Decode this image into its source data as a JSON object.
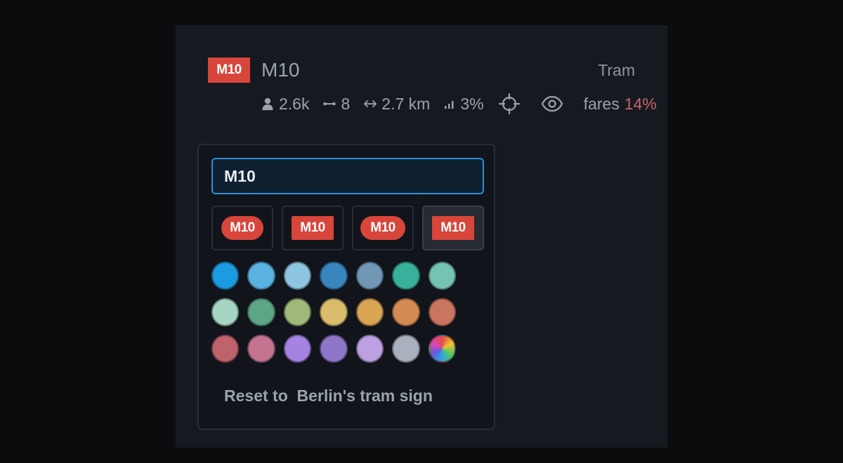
{
  "line": {
    "badge": "M10",
    "name": "M10",
    "type": "Tram",
    "badge_color": "#d8453a"
  },
  "stats": {
    "riders": "2.6k",
    "stops": "8",
    "length": "2.7 km",
    "share": "3%",
    "fares_label": "fares",
    "fares_value": "14%"
  },
  "picker": {
    "input_value": "M10",
    "style_options": [
      {
        "label": "M10",
        "shape": "pill"
      },
      {
        "label": "M10",
        "shape": "rectangle"
      },
      {
        "label": "M10",
        "shape": "pill"
      },
      {
        "label": "M10",
        "shape": "square",
        "selected": true
      }
    ],
    "swatch_rows": [
      [
        "#1b9be0",
        "#5ab2e0",
        "#8ec5e0",
        "#3a85bd",
        "#7097b4",
        "#38b19c",
        "#75c4b2"
      ],
      [
        "#a6d6c3",
        "#5da584",
        "#a0b97a",
        "#d9bd6d",
        "#d9a552",
        "#d38b52",
        "#c97562"
      ],
      [
        "#be626c",
        "#c27490",
        "#a583e0",
        "#8e76c9",
        "#bca0e2",
        "#a9b0be",
        "rainbow"
      ]
    ],
    "reset_label": "Reset to  Berlin's tram sign"
  },
  "icons": [
    "person-icon",
    "stops-icon",
    "length-arrows-icon",
    "signal-bars-icon",
    "crosshair-icon",
    "eye-icon"
  ]
}
